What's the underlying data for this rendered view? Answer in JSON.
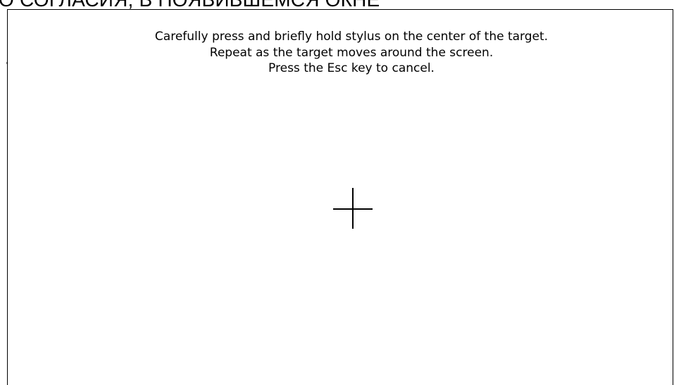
{
  "caption": {
    "text": "О СОГЛАСИЯ, В ПОЯВИВШЕМСЯ ОКНЕ"
  },
  "calibration": {
    "instructions": [
      "Carefully press and briefly hold stylus on the center of the target.",
      "Repeat as the target moves around the screen.",
      "Press the Esc key to cancel."
    ],
    "target_icon": "crosshair-icon"
  },
  "colors": {
    "background": "#ffffff",
    "foreground": "#000000"
  }
}
